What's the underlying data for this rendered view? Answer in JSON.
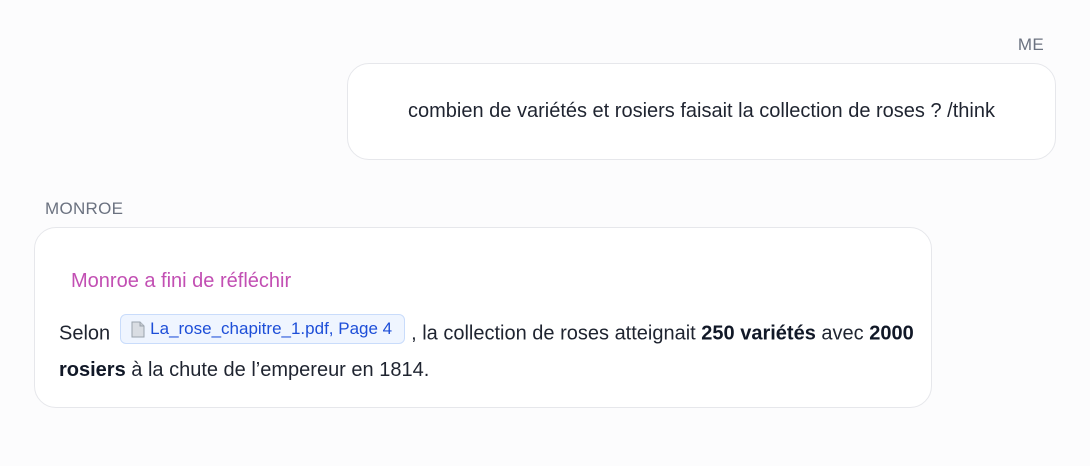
{
  "conversation": {
    "user": {
      "label": "ME",
      "message": "combien de variétés et rosiers faisait la collection de roses ? /think"
    },
    "assistant": {
      "label": "MONROE",
      "thinking_status": "Monroe a fini de réfléchir",
      "answer": {
        "intro": "Selon",
        "citation": {
          "icon": "document-icon",
          "label": "La_rose_chapitre_1.pdf, Page 4"
        },
        "part1": ", la collection de roses atteignait ",
        "bold1": "250 variétés",
        "part2": " avec ",
        "bold2": "2000 rosiers",
        "part3": " à la chute de l’empereur en 1814."
      }
    }
  },
  "colors": {
    "thinking": "#c24fb3",
    "citation_text": "#1d4ed8",
    "citation_bg": "#eff5ff",
    "label": "#6b7280"
  }
}
